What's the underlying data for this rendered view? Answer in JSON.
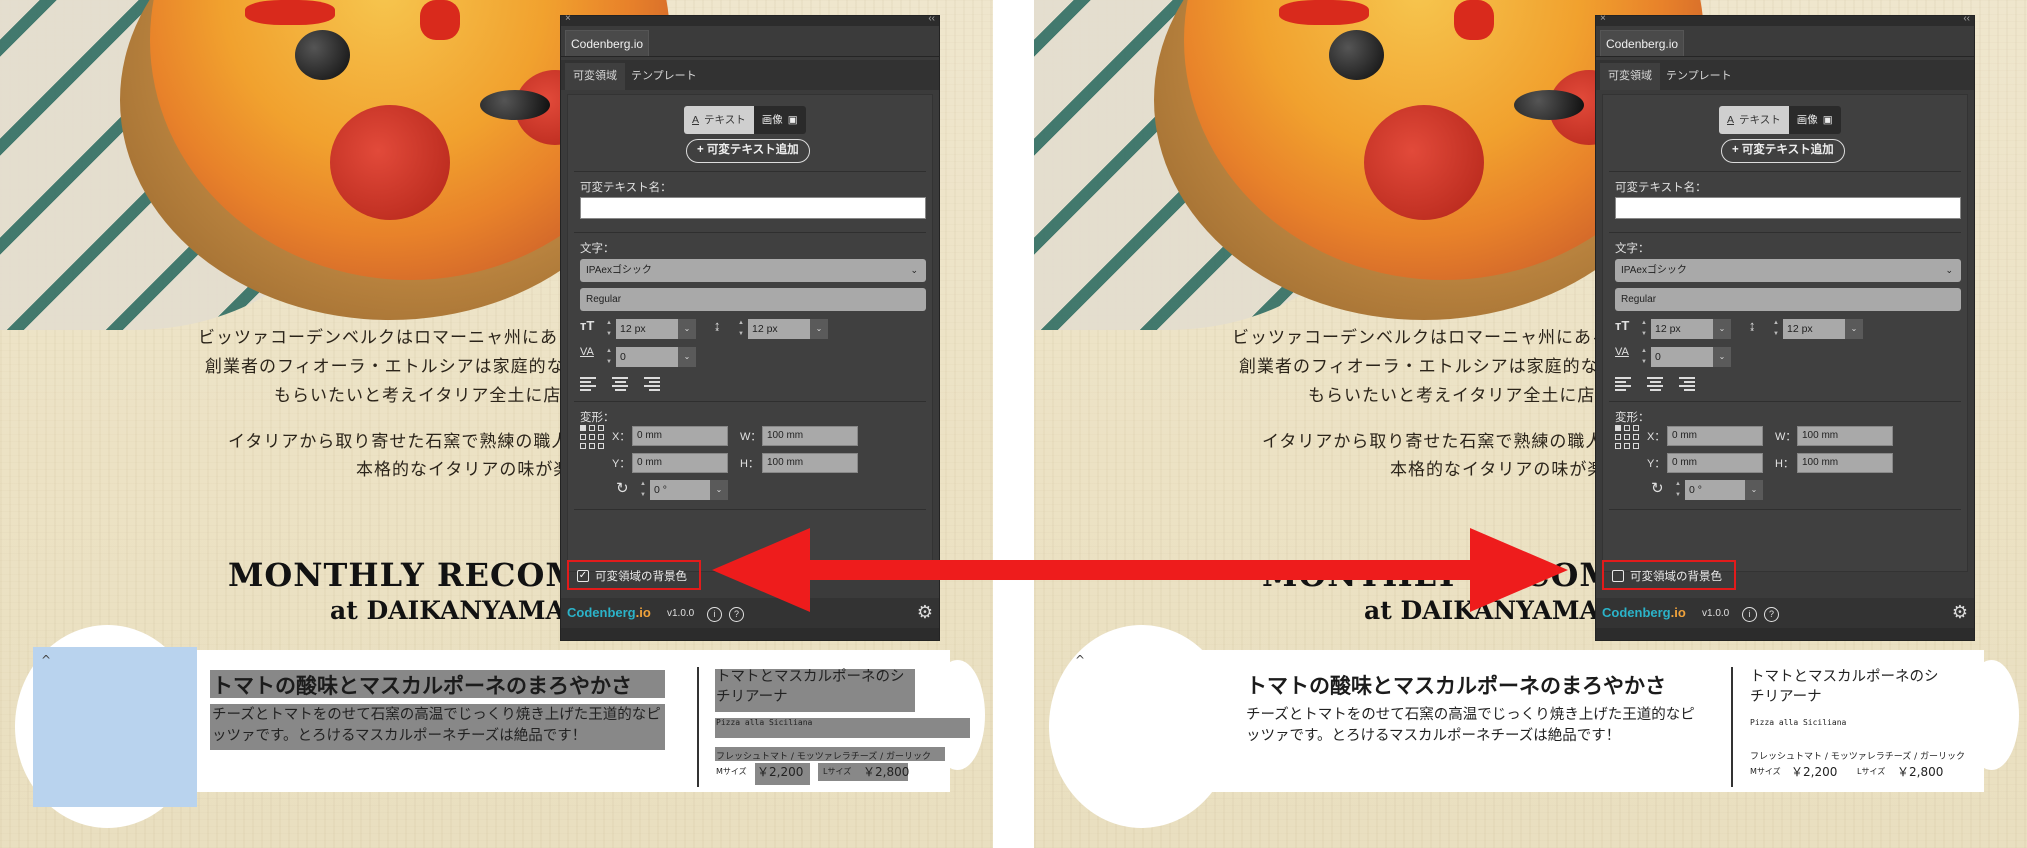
{
  "panel": {
    "window_title": "Codenberg.io",
    "tabs": [
      "可変領域",
      "テンプレート"
    ],
    "segment": {
      "text_label": "テキスト",
      "image_label": "画像"
    },
    "add_button": "+ 可変テキスト追加",
    "text_name_label": "可変テキスト名：",
    "font_label": "文字：",
    "font_family": "IPAexゴシック",
    "font_style": "Regular",
    "font_size": "12 px",
    "line_height": "12 px",
    "tracking": "0",
    "transform_label": "変形：",
    "x_label": "X：",
    "y_label": "Y：",
    "w_label": "W：",
    "h_label": "H：",
    "x_value": "0 mm",
    "y_value": "0 mm",
    "w_value": "100 mm",
    "h_value": "100 mm",
    "rotation": "0 °",
    "bg_checkbox_label": "可変領域の背景色",
    "brand_part1": "Codenberg",
    "brand_part2": ".io",
    "version": "v1.0.0",
    "info_icon": "i",
    "help_icon": "?",
    "gear_icon": "⚙"
  },
  "left_state": {
    "bg_checked": true,
    "check_glyph": "✓"
  },
  "right_state": {
    "bg_checked": false,
    "check_glyph": ""
  },
  "background": {
    "lines": [
      "ビッツァコーデンベルクはロマーニャ州にある小",
      "創業者のフィオーラ・エトルシアは家庭的なピ",
      "もらいたいと考えイタリア全土に店舗",
      "イタリアから取り寄せた石窯で熟練の職人",
      "本格的なイタリアの味が楽"
    ],
    "headline": "MONTHLY RECOMM",
    "subline": "at DAIKANYAMA"
  },
  "card": {
    "caret": "^",
    "title": "トマトの酸味とマスカルポーネのまろやかさ",
    "desc": "チーズとトマトをのせて石窯の高温でじっくり焼き上げた王道的なピッツァです。とろけるマスカルポーネチーズは絶品です！",
    "name": "トマトとマスカルポーネのシチリアーナ",
    "sub": "Pizza alla Siciliana",
    "ingredients": "フレッシュトマト / モッツァレラチーズ / ガーリック",
    "m_size": "Mサイズ",
    "m_price": "￥2,200",
    "l_size": "Lサイズ",
    "l_price": "￥2,800"
  },
  "colors": {
    "highlight": "#e21b1b",
    "arrow": "#ee1c1c",
    "panel_bg": "#3b3b3b",
    "brand_teal": "#2bb3c9",
    "brand_orange": "#f0a23b",
    "image_placeholder": "#b9d3ee"
  }
}
